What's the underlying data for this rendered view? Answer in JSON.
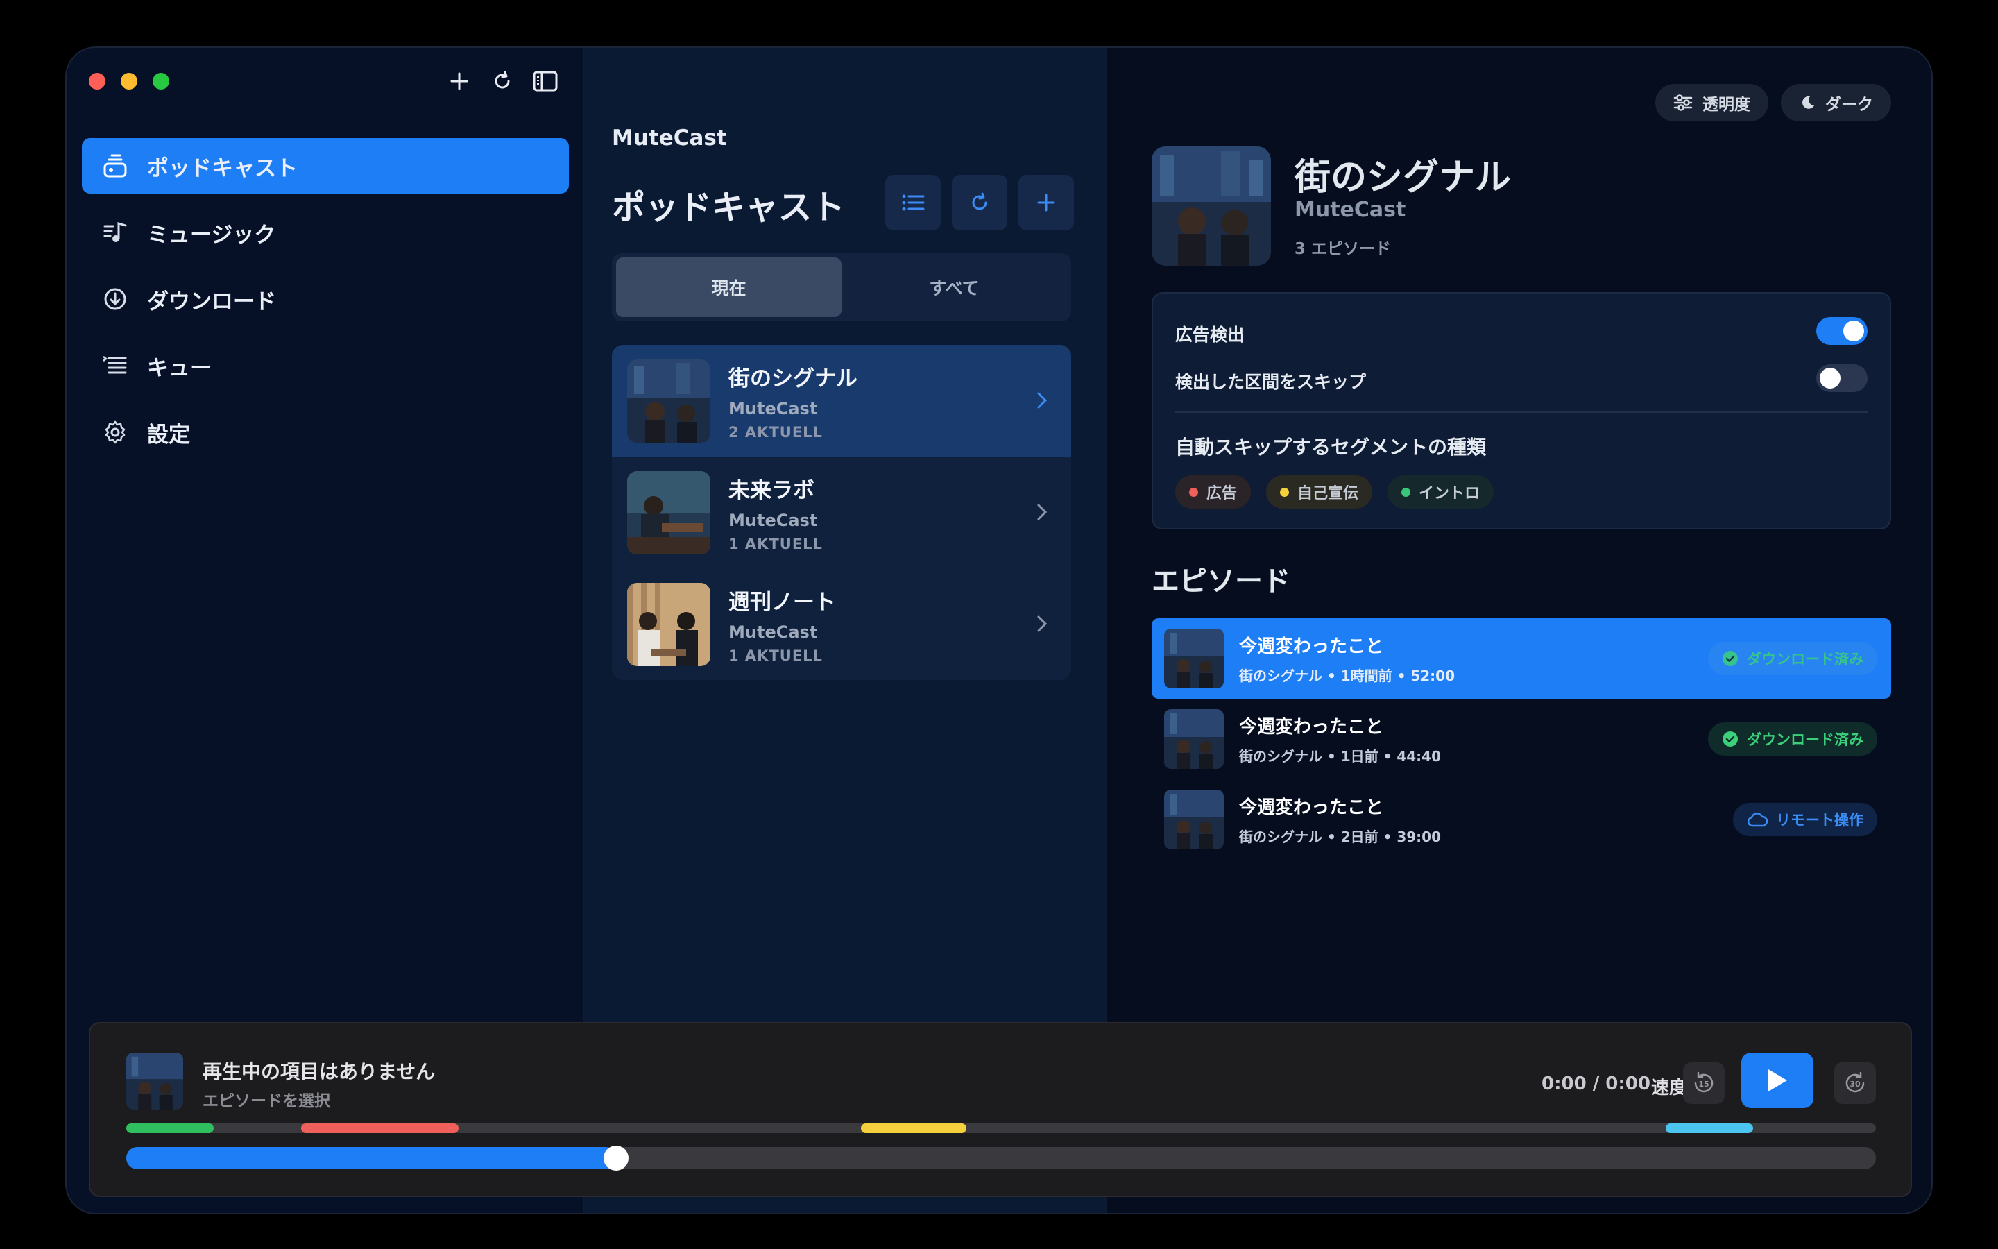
{
  "sidebar": {
    "items": [
      {
        "label": "ポッドキャスト",
        "icon": "podcast-icon",
        "active": true
      },
      {
        "label": "ミュージック",
        "icon": "music-icon",
        "active": false
      },
      {
        "label": "ダウンロード",
        "icon": "download-icon",
        "active": false
      },
      {
        "label": "キュー",
        "icon": "queue-icon",
        "active": false
      },
      {
        "label": "設定",
        "icon": "gear-icon",
        "active": false
      }
    ]
  },
  "middle": {
    "brand": "MuteCast",
    "title": "ポッドキャスト",
    "segments": [
      "現在",
      "すべて"
    ],
    "podcasts": [
      {
        "title": "街のシグナル",
        "publisher": "MuteCast",
        "count": "2 AKTUELL"
      },
      {
        "title": "未来ラボ",
        "publisher": "MuteCast",
        "count": "1 AKTUELL"
      },
      {
        "title": "週刊ノート",
        "publisher": "MuteCast",
        "count": "1 AKTUELL"
      }
    ]
  },
  "right": {
    "pills": {
      "opacity": "透明度",
      "theme": "ダーク"
    },
    "show": {
      "title": "街のシグナル",
      "publisher": "MuteCast",
      "count": "3 エピソード"
    },
    "settings": {
      "ad_detect": "広告検出",
      "ad_detect_on": true,
      "skip_detected": "検出した区間をスキップ",
      "skip_detected_on": false,
      "segment_heading": "自動スキップするセグメントの種類",
      "tags": [
        {
          "label": "広告",
          "color": "#f0605a"
        },
        {
          "label": "自己宣伝",
          "color": "#f5cf3c"
        },
        {
          "label": "イントロ",
          "color": "#3bc77a"
        }
      ]
    },
    "episodes_heading": "エピソード",
    "episodes": [
      {
        "title": "今週変わったこと",
        "meta": "街のシグナル • 1時間前 • 52:00",
        "badge": "ダウンロード済み"
      },
      {
        "title": "今週変わったこと",
        "meta": "街のシグナル • 1日前 • 44:40",
        "badge": "ダウンロード済み"
      },
      {
        "title": "今週変わったこと",
        "meta": "街のシグナル • 2日前 • 39:00",
        "badge": "リモート操作"
      }
    ]
  },
  "player": {
    "title": "再生中の項目はありません",
    "subtitle": "エピソードを選択",
    "time": "0:00 / 0:00",
    "speed": "速度",
    "skip_back": "15",
    "skip_forward": "30",
    "progress_fraction": 0.28,
    "segments": [
      {
        "start": 0.0,
        "end": 0.05,
        "color": "#2fbf5f"
      },
      {
        "start": 0.1,
        "end": 0.19,
        "color": "#f0605a"
      },
      {
        "start": 0.42,
        "end": 0.48,
        "color": "#f5cf3c"
      },
      {
        "start": 0.88,
        "end": 0.93,
        "color": "#4cc4f0"
      }
    ]
  },
  "colors": {
    "accent": "#1e7ef5",
    "success": "#3bd17a"
  }
}
